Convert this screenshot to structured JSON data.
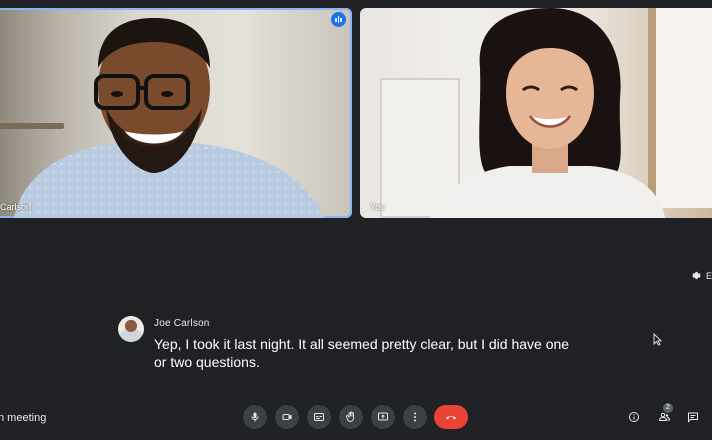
{
  "tiles": {
    "left_name": "Carlson",
    "right_name": "You"
  },
  "side": {
    "label": "E"
  },
  "caption": {
    "speaker": "Joe Carlson",
    "line1": "Yep, I took it last night. It all seemed pretty clear, but I did have one",
    "line2": "or two questions."
  },
  "bottom": {
    "meeting_label": "n meeting",
    "participants_count": "2",
    "controls": [
      {
        "name": "mic",
        "icon": "microphone-icon"
      },
      {
        "name": "camera",
        "icon": "camera-icon"
      },
      {
        "name": "captions",
        "icon": "captions-icon"
      },
      {
        "name": "raise-hand",
        "icon": "hand-icon"
      },
      {
        "name": "present",
        "icon": "present-screen-icon"
      },
      {
        "name": "more",
        "icon": "more-vert-icon"
      },
      {
        "name": "leave",
        "icon": "end-call-icon"
      }
    ],
    "right_icons": [
      "info-icon",
      "people-icon",
      "chat-icon"
    ]
  },
  "colors": {
    "background": "#202124",
    "control": "#3c4043",
    "end_call": "#ea4335",
    "active_border": "#8ab4f8",
    "speaking_badge": "#1a73e8"
  }
}
